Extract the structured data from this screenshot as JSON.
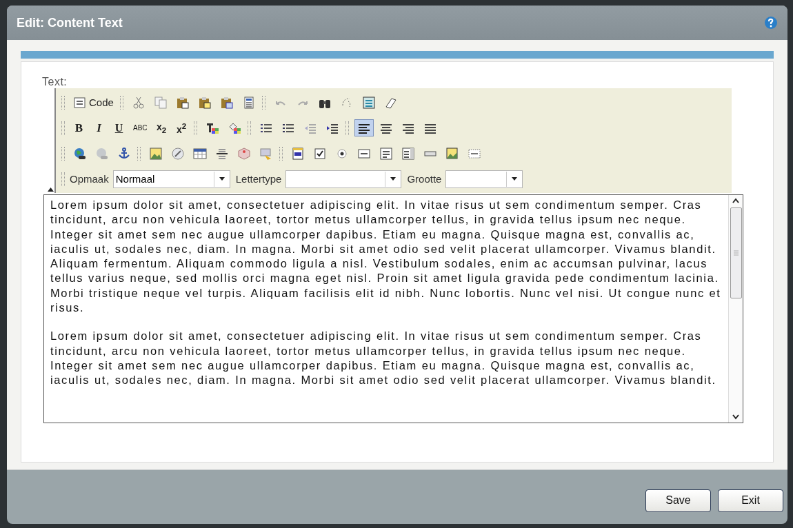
{
  "dialog": {
    "title": "Edit: Content Text"
  },
  "field": {
    "label": "Text:"
  },
  "toolbar": {
    "rows": [
      {
        "groups": [
          [
            {
              "kind": "source",
              "label": "Code"
            }
          ],
          [
            {
              "kind": "cut"
            },
            {
              "kind": "copy"
            },
            {
              "kind": "paste"
            },
            {
              "kind": "pastetext"
            },
            {
              "kind": "pasteword"
            },
            {
              "kind": "template"
            }
          ],
          [
            {
              "kind": "undo"
            },
            {
              "kind": "redo"
            },
            {
              "kind": "find"
            },
            {
              "kind": "replace"
            },
            {
              "kind": "selectall"
            },
            {
              "kind": "eraser"
            }
          ]
        ]
      },
      {
        "groups": [
          [
            {
              "kind": "bold",
              "glyph": "B"
            },
            {
              "kind": "italic",
              "glyph": "I"
            },
            {
              "kind": "underline",
              "glyph": "U"
            },
            {
              "kind": "strike",
              "glyph": "ABC"
            },
            {
              "kind": "subscript",
              "glyph": "x$_{2}$"
            },
            {
              "kind": "superscript",
              "glyph": "x$^{2}$"
            }
          ],
          [
            {
              "kind": "textcolor"
            },
            {
              "kind": "bgcolor"
            }
          ],
          [
            {
              "kind": "ol"
            },
            {
              "kind": "ul"
            },
            {
              "kind": "outdent"
            },
            {
              "kind": "indent"
            }
          ],
          [
            {
              "kind": "alignleft",
              "selected": true
            },
            {
              "kind": "aligncenter",
              "selected": false
            },
            {
              "kind": "alignright",
              "selected": false
            },
            {
              "kind": "justify",
              "selected": false
            }
          ]
        ]
      },
      {
        "groups": [
          [
            {
              "kind": "link"
            },
            {
              "kind": "unlink"
            },
            {
              "kind": "anchor"
            }
          ],
          [
            {
              "kind": "image"
            },
            {
              "kind": "flash"
            },
            {
              "kind": "table"
            },
            {
              "kind": "rule"
            },
            {
              "kind": "smiley"
            },
            {
              "kind": "specialchar"
            }
          ],
          [
            {
              "kind": "form"
            },
            {
              "kind": "checkbox"
            },
            {
              "kind": "radio"
            },
            {
              "kind": "textfield"
            },
            {
              "kind": "textarea"
            },
            {
              "kind": "select"
            },
            {
              "kind": "button"
            },
            {
              "kind": "imagebutton"
            },
            {
              "kind": "hidden"
            }
          ]
        ]
      }
    ],
    "selects": [
      {
        "label": "Opmaak",
        "value": "Normaal"
      },
      {
        "label": "Lettertype"
      },
      {
        "label": "Grootte"
      }
    ]
  },
  "editor": {
    "paragraphs": [
      "Lorem ipsum dolor sit amet, consectetuer adipiscing elit. In vitae risus ut sem condimentum semper. Cras tincidunt, arcu non vehicula laoreet, tortor metus ullamcorper tellus, in gravida tellus ipsum nec neque. Integer sit amet sem nec augue ullamcorper dapibus. Etiam eu magna. Quisque magna est, convallis ac, iaculis ut, sodales nec, diam. In magna. Morbi sit amet odio sed velit placerat ullamcorper. Vivamus blandit. Aliquam fermentum. Aliquam commodo ligula a nisl. Vestibulum sodales, enim ac accumsan pulvinar, lacus tellus varius neque, sed mollis orci magna eget nisl. Proin sit amet ligula gravida pede condimentum lacinia. Morbi tristique neque vel turpis. Aliquam facilisis elit id nibh. Nunc lobortis. Nunc vel nisi. Ut congue nunc et risus.",
      "Lorem ipsum dolor sit amet, consectetuer adipiscing elit. In vitae risus ut sem condimentum semper. Cras tincidunt, arcu non vehicula laoreet, tortor metus ullamcorper tellus, in gravida tellus ipsum nec neque. Integer sit amet sem nec augue ullamcorper dapibus. Etiam eu magna. Quisque magna est, convallis ac, iaculis ut, sodales nec, diam. In magna. Morbi sit amet odio sed velit placerat ullamcorper. Vivamus blandit."
    ]
  },
  "buttons": [
    {
      "label": "Save"
    },
    {
      "label": "Exit"
    }
  ]
}
